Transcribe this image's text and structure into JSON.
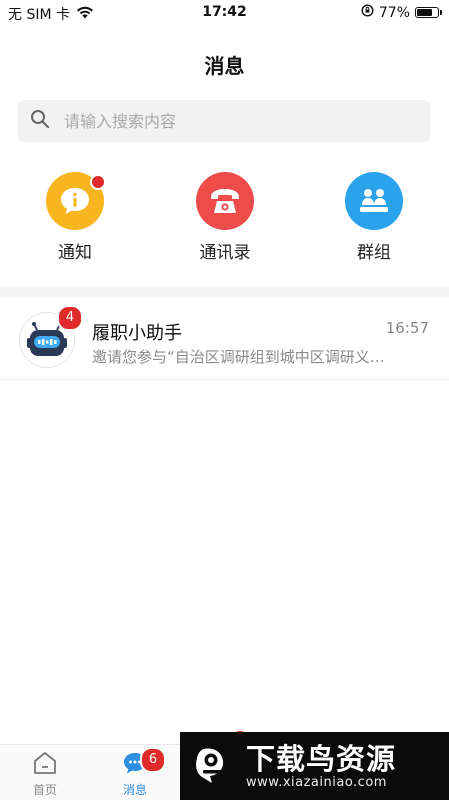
{
  "status_bar": {
    "carrier": "无 SIM 卡",
    "time": "17:42",
    "battery_percent": "77%",
    "battery_level": 0.77,
    "icons": [
      "wifi-icon",
      "orientation-lock-icon",
      "battery-icon"
    ]
  },
  "header": {
    "title": "消息"
  },
  "search": {
    "placeholder": "请输入搜索内容",
    "icon": "search-icon"
  },
  "quick_actions": [
    {
      "label": "通知",
      "icon": "notice-icon",
      "color": "#f7b51f",
      "has_dot": true
    },
    {
      "label": "通讯录",
      "icon": "phone-icon",
      "color": "#ee4b4b",
      "has_dot": false
    },
    {
      "label": "群组",
      "icon": "group-icon",
      "color": "#2aa3ec",
      "has_dot": false
    }
  ],
  "messages": [
    {
      "name": "履职小助手",
      "time": "16:57",
      "preview": "邀请您参与“自治区调研组到城中区调研义…",
      "unread": "4",
      "avatar": "robot-icon"
    }
  ],
  "tab_bar": {
    "items": [
      {
        "label": "首页",
        "icon": "home-icon",
        "active": false
      },
      {
        "label": "消息",
        "icon": "message-icon",
        "active": true,
        "badge": "6"
      }
    ],
    "accent": "#2e8fe0"
  },
  "watermark": {
    "title": "下载鸟资源",
    "url": "www.xiazainiao.com"
  }
}
